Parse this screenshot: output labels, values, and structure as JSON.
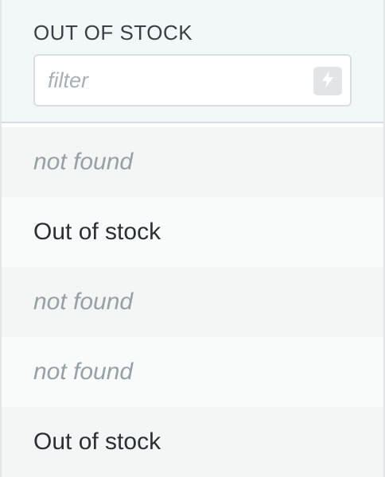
{
  "column": {
    "title": "OUT OF STOCK",
    "filter": {
      "placeholder": "filter",
      "value": "",
      "button_icon": "lightning-bolt-icon"
    }
  },
  "rows": [
    {
      "text": "not found",
      "missing": true
    },
    {
      "text": "Out of stock",
      "missing": false
    },
    {
      "text": "not found",
      "missing": true
    },
    {
      "text": "not found",
      "missing": true
    },
    {
      "text": "Out of stock",
      "missing": false
    }
  ],
  "colors": {
    "header_bg": "#f2f7f8",
    "row_odd": "#f4f5f5",
    "row_even": "#f9fbfb",
    "missing_text": "#97a0a7",
    "value_text": "#2b3035"
  }
}
